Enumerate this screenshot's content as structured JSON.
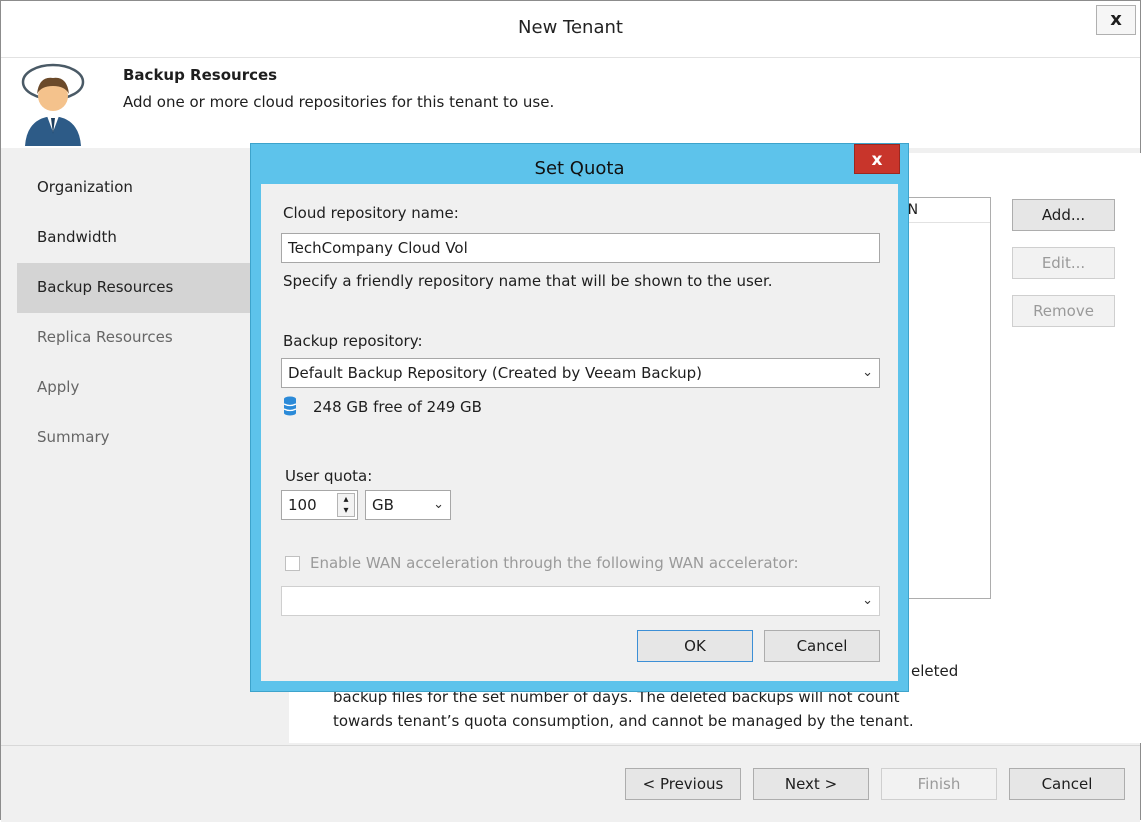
{
  "window": {
    "title": "New Tenant",
    "close": "x"
  },
  "header": {
    "title": "Backup Resources",
    "description": "Add one or more cloud repositories for this tenant to use."
  },
  "sidebar": {
    "items": [
      {
        "label": "Organization"
      },
      {
        "label": "Bandwidth"
      },
      {
        "label": "Backup Resources"
      },
      {
        "label": "Replica Resources"
      },
      {
        "label": "Apply"
      },
      {
        "label": "Summary"
      }
    ]
  },
  "main": {
    "list_column_partial": "AN",
    "buttons": {
      "add": "Add...",
      "edit": "Edit...",
      "remove": "Remove"
    },
    "note_partial_1": "eleted",
    "note_line2": "backup files for the set number of days. The deleted backups will not count",
    "note_line3": "towards tenant’s quota consumption, and cannot be managed by the tenant."
  },
  "footer": {
    "previous": "< Previous",
    "next": "Next >",
    "finish": "Finish",
    "cancel": "Cancel"
  },
  "dialog": {
    "title": "Set Quota",
    "close": "x",
    "repo_name_label": "Cloud repository name:",
    "repo_name_value": "TechCompany Cloud Vol",
    "repo_name_hint": "Specify a friendly repository name that will be shown to the user.",
    "backup_repo_label": "Backup repository:",
    "backup_repo_value": "Default Backup Repository (Created by Veeam Backup)",
    "free_space": "248 GB free of 249 GB",
    "user_quota_label": "User quota:",
    "user_quota_value": "100",
    "unit_value": "GB",
    "wan_checkbox_label": "Enable WAN acceleration through the following WAN accelerator:",
    "wan_value": "",
    "ok": "OK",
    "cancel": "Cancel"
  }
}
